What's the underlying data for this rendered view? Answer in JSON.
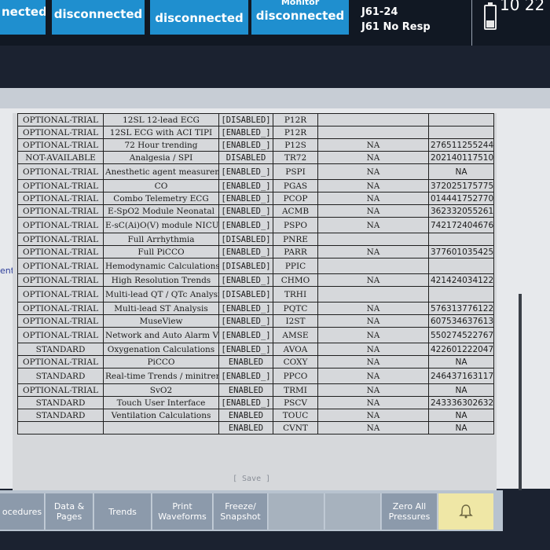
{
  "status_bar": {
    "tiles": [
      {
        "main": "nected"
      },
      {
        "main": "disconnected"
      },
      {
        "main": "disconnected"
      },
      {
        "sup": "Monitor",
        "main": "disconnected"
      }
    ],
    "resp_line1": "J61-24",
    "resp_line2": "J61 No Resp",
    "clock": "10 22"
  },
  "left_fragment": "ent",
  "table": {
    "rows": [
      [
        "OPTIONAL-TRIAL",
        "12SL 12-lead ECG",
        "[DISABLED]",
        "P12R",
        "",
        ""
      ],
      [
        "OPTIONAL-TRIAL",
        "12SL ECG with ACI TIPI",
        "[ENABLED_]",
        "P12R",
        "",
        ""
      ],
      [
        "OPTIONAL-TRIAL",
        "72 Hour trending",
        "[ENABLED_]",
        "P12S",
        "NA",
        "276511255244"
      ],
      [
        "NOT-AVAILABLE",
        "Analgesia / SPI",
        "DISABLED",
        "TR72",
        "NA",
        "202140117510"
      ],
      [
        "OPTIONAL-TRIAL",
        "Anesthetic agent measurement",
        "[ENABLED_]",
        "PSPI",
        "NA",
        "NA"
      ],
      [
        "OPTIONAL-TRIAL",
        "CO",
        "[ENABLED_]",
        "PGAS",
        "NA",
        "372025175775"
      ],
      [
        "OPTIONAL-TRIAL",
        "Combo Telemetry ECG",
        "[ENABLED_]",
        "PCOP",
        "NA",
        "014441752770"
      ],
      [
        "OPTIONAL-TRIAL",
        "E-SpO2 Module Neonatal",
        "[ENABLED_]",
        "ACMB",
        "NA",
        "362332055261"
      ],
      [
        "OPTIONAL-TRIAL",
        "E-sC(Ai)O(V) module NICU SW",
        "[ENABLED_]",
        "PSPO",
        "NA",
        "742172404676"
      ],
      [
        "OPTIONAL-TRIAL",
        "Full Arrhythmia",
        "[DISABLED]",
        "PNRE",
        "",
        ""
      ],
      [
        "OPTIONAL-TRIAL",
        "Full PiCCO",
        "[ENABLED_]",
        "PARR",
        "NA",
        "377601035425"
      ],
      [
        "OPTIONAL-TRIAL",
        "Hemodynamic Calculations",
        "[DISABLED]",
        "PPIC",
        "",
        ""
      ],
      [
        "OPTIONAL-TRIAL",
        "High Resolution Trends",
        "[ENABLED_]",
        "CHMO",
        "NA",
        "421424034122"
      ],
      [
        "OPTIONAL-TRIAL",
        "Multi-lead QT / QTc Analysis",
        "[DISABLED]",
        "TRHI",
        "",
        ""
      ],
      [
        "OPTIONAL-TRIAL",
        "Multi-lead ST Analysis",
        "[ENABLED_]",
        "PQTC",
        "NA",
        "576313776122"
      ],
      [
        "OPTIONAL-TRIAL",
        "MuseView",
        "[ENABLED_]",
        "I2ST",
        "NA",
        "607534637613"
      ],
      [
        "OPTIONAL-TRIAL",
        "Network and Auto Alarm View",
        "[ENABLED_]",
        "AMSE",
        "NA",
        "550274522767"
      ],
      [
        "STANDARD",
        "Oxygenation Calculations",
        "[ENABLED_]",
        "AVOA",
        "NA",
        "422601222047"
      ],
      [
        "OPTIONAL-TRIAL",
        "PiCCO",
        "ENABLED",
        "COXY",
        "NA",
        "NA"
      ],
      [
        "STANDARD",
        "Real-time Trends / minitrends",
        "[ENABLED_]",
        "PPCO",
        "NA",
        "246437163117"
      ],
      [
        "OPTIONAL-TRIAL",
        "SvO2",
        "ENABLED",
        "TRMI",
        "NA",
        "NA"
      ],
      [
        "STANDARD",
        "Touch User Interface",
        "[ENABLED_]",
        "PSCV",
        "NA",
        "243336302632"
      ],
      [
        "STANDARD",
        "Ventilation Calculations",
        "ENABLED",
        "TOUC",
        "NA",
        "NA"
      ],
      [
        "",
        "",
        "ENABLED",
        "CVNT",
        "NA",
        "NA"
      ]
    ]
  },
  "save_label": "[ Save ]",
  "toolbar": {
    "buttons": [
      "ocedures",
      "Data & Pages",
      "Trends",
      "Print Waveforms",
      "Freeze/ Snapshot",
      "",
      "",
      "Zero All Pressures"
    ],
    "alarm_icon": "alarm-bell-icon"
  }
}
